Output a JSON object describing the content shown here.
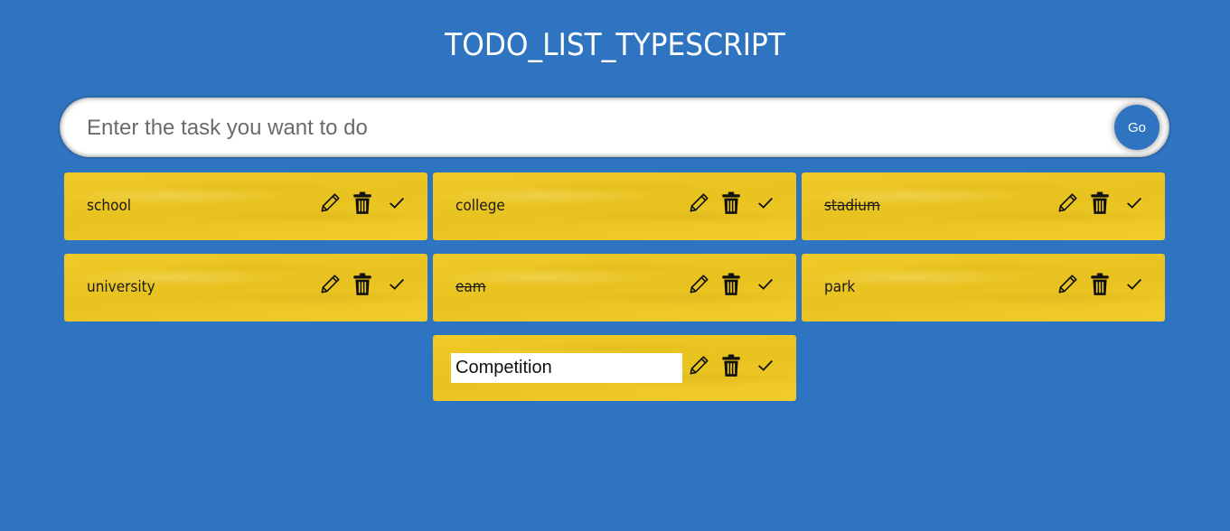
{
  "header": {
    "title": "TODO_LIST_TYPESCRIPT"
  },
  "input_form": {
    "placeholder": "Enter the task you want to do",
    "value": "",
    "go_label": "Go"
  },
  "todos": [
    {
      "text": "school",
      "done": false,
      "editing": false
    },
    {
      "text": "college",
      "done": false,
      "editing": false
    },
    {
      "text": "stadium",
      "done": true,
      "editing": false
    },
    {
      "text": "university",
      "done": false,
      "editing": false
    },
    {
      "text": "eam",
      "done": true,
      "editing": false
    },
    {
      "text": "park",
      "done": false,
      "editing": false
    },
    {
      "text": "Competition",
      "done": false,
      "editing": true
    }
  ],
  "icons": {
    "edit": "pencil-icon",
    "delete": "trash-icon",
    "done": "check-icon"
  },
  "colors": {
    "background": "#2f74c0",
    "card": "#f0cb27",
    "go_button": "#2f74c0"
  }
}
